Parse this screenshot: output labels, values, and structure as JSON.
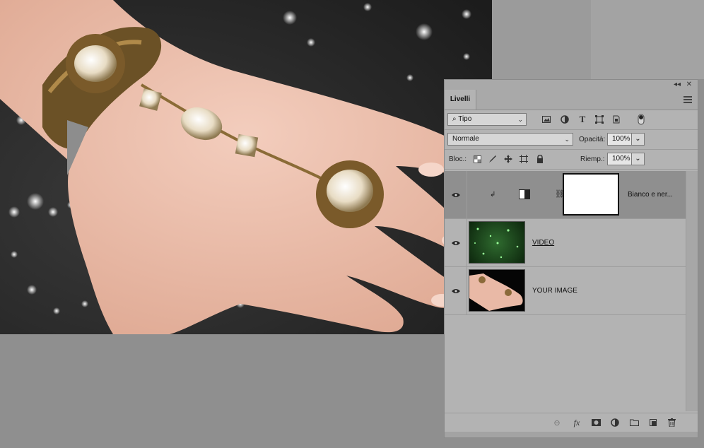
{
  "document": {
    "canvas_color": "#8f8f8f"
  },
  "panel": {
    "collapse_label": "◂◂",
    "close_label": "✕",
    "tab_label": "Livelli",
    "filter": {
      "value": "Tipo"
    },
    "blend_mode": {
      "value": "Normale"
    },
    "opacity": {
      "label": "Opacità:",
      "value": "100%"
    },
    "lock": {
      "label": "Bloc.:"
    },
    "fill": {
      "label": "Riemp.:",
      "value": "100%"
    },
    "layers": [
      {
        "name": "Bianco e ner...",
        "type": "adjustment",
        "selected": true
      },
      {
        "name": "VIDEO",
        "type": "video",
        "selected": false
      },
      {
        "name": "YOUR IMAGE",
        "type": "image",
        "selected": false
      }
    ],
    "footer_icons": [
      "link-icon",
      "fx-icon",
      "mask-icon",
      "adjustment-icon",
      "folder-icon",
      "new-layer-icon",
      "trash-icon"
    ],
    "fx_label": "fx"
  },
  "colors": {
    "panel_bg": "#b3b3b3",
    "active_row": "#8f8f8f"
  }
}
